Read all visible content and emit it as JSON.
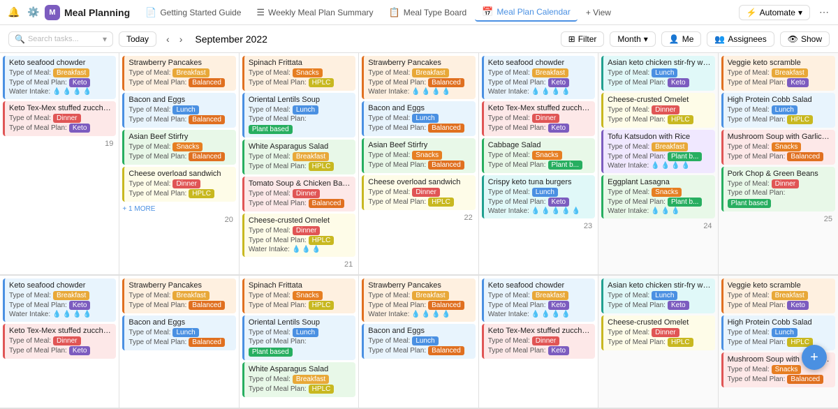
{
  "app": {
    "name": "Meal Planning",
    "icon": "M"
  },
  "tabs": [
    {
      "id": "getting-started",
      "label": "Getting Started Guide",
      "icon": "📄",
      "active": false
    },
    {
      "id": "weekly-summary",
      "label": "Weekly Meal Plan Summary",
      "icon": "☰",
      "active": false
    },
    {
      "id": "meal-type-board",
      "label": "Meal Type Board",
      "icon": "📋",
      "active": false
    },
    {
      "id": "meal-plan-calendar",
      "label": "Meal Plan Calendar",
      "icon": "📅",
      "active": true
    },
    {
      "id": "view",
      "label": "+ View",
      "icon": "",
      "active": false
    }
  ],
  "toolbar": {
    "search_placeholder": "Search tasks...",
    "today_label": "Today",
    "date_range": "September 2022",
    "filter_label": "Filter",
    "month_label": "Month",
    "me_label": "Me",
    "assignees_label": "Assignees",
    "show_label": "Show"
  },
  "automate": {
    "label": "Automate"
  },
  "week1": {
    "days": [
      {
        "num": "19",
        "cards": [
          {
            "title": "Keto seafood chowder",
            "type": "Breakfast",
            "plan": "Keto",
            "water": 4,
            "color": "blue"
          },
          {
            "title": "Keto Tex-Mex stuffed zucchini boat",
            "type": "Dinner",
            "plan": "Keto",
            "color": "pink"
          }
        ]
      },
      {
        "num": "20",
        "cards": [
          {
            "title": "Strawberry Pancakes",
            "type": "Breakfast",
            "plan": "Balanced",
            "water": 0,
            "color": "orange"
          },
          {
            "title": "Bacon and Eggs",
            "type": "Lunch",
            "plan": "Balanced",
            "color": "blue"
          },
          {
            "title": "Asian Beef Stirfry",
            "type": "Snacks",
            "plan": "Balanced",
            "color": "green"
          },
          {
            "title": "Cheese overload sandwich",
            "type": "Dinner",
            "plan": "HPLC",
            "color": "yellow"
          }
        ],
        "more": 1
      },
      {
        "num": "21",
        "cards": [
          {
            "title": "Spinach Frittata",
            "type": "Snacks",
            "plan": "HPLC",
            "color": "orange"
          },
          {
            "title": "Oriental Lentils Soup",
            "type": "Lunch",
            "plan": "Plant based",
            "color": "blue"
          },
          {
            "title": "White Asparagus Salad",
            "type": "Breakfast",
            "plan": "HPLC",
            "color": "green"
          },
          {
            "title": "Tomato Soup & Chicken Barbecue",
            "type": "Dinner",
            "plan": "Balanced",
            "color": "pink"
          },
          {
            "title": "Cheese-crusted Omelet",
            "type": "Dinner",
            "plan": "HPLC",
            "water": 3,
            "color": "yellow"
          }
        ]
      },
      {
        "num": "22",
        "cards": [
          {
            "title": "Strawberry Pancakes",
            "type": "Breakfast",
            "plan": "Balanced",
            "water": 4,
            "color": "orange"
          },
          {
            "title": "Bacon and Eggs",
            "type": "Lunch",
            "plan": "Balanced",
            "color": "blue"
          },
          {
            "title": "Asian Beef Stirfry",
            "type": "Snacks",
            "plan": "Balanced",
            "color": "green"
          },
          {
            "title": "Cheese overload sandwich",
            "type": "Dinner",
            "plan": "HPLC",
            "color": "yellow"
          }
        ]
      },
      {
        "num": "23",
        "cards": [
          {
            "title": "Keto seafood chowder",
            "type": "Breakfast",
            "plan": "Keto",
            "water": 4,
            "color": "blue"
          },
          {
            "title": "Keto Tex-Mex stuffed zucchini b.",
            "type": "Dinner",
            "plan": "Keto",
            "color": "pink"
          },
          {
            "title": "Cabbage Salad",
            "type": "Snacks",
            "plan": "Plant b...",
            "water": 0,
            "color": "green"
          },
          {
            "title": "Crispy keto tuna burgers",
            "type": "Lunch",
            "plan": "Keto",
            "water": 5,
            "color": "teal"
          }
        ]
      },
      {
        "num": "24",
        "cards": [
          {
            "title": "Asian keto chicken stir-fry with bro.",
            "type": "Lunch",
            "plan": "Keto",
            "color": "teal"
          },
          {
            "title": "Cheese-crusted Omelet",
            "type": "Dinner",
            "plan": "HPLC",
            "color": "yellow"
          },
          {
            "title": "Tofu Katsudon with Rice",
            "type": "Breakfast",
            "plan": "Plant b...",
            "water": 4,
            "color": "purple"
          },
          {
            "title": "Eggplant Lasagna",
            "type": "Snacks",
            "plan": "Plant b...",
            "water": 3,
            "color": "green"
          }
        ]
      },
      {
        "num": "25",
        "cards": [
          {
            "title": "Veggie keto scramble",
            "type": "Breakfast",
            "plan": "Keto",
            "color": "orange"
          },
          {
            "title": "High Protein Cobb Salad",
            "type": "Lunch",
            "plan": "HPLC",
            "color": "blue"
          },
          {
            "title": "Mushroom Soup with Garlic Bre.",
            "type": "Snacks",
            "plan": "Balanced",
            "color": "pink"
          },
          {
            "title": "Pork Chop & Green Beans",
            "type": "Dinner",
            "plan": "Plant based",
            "color": "green"
          }
        ]
      }
    ]
  },
  "week2": {
    "days": [
      {
        "num": "",
        "cards": [
          {
            "title": "Keto seafood chowder",
            "type": "Breakfast",
            "plan": "Keto",
            "water": 4,
            "color": "blue"
          },
          {
            "title": "Keto Tex-Mex stuffed zucchini b.",
            "type": "Dinner",
            "plan": "Keto",
            "color": "pink"
          }
        ]
      },
      {
        "num": "",
        "cards": [
          {
            "title": "Strawberry Pancakes",
            "type": "Breakfast",
            "plan": "Balanced",
            "water": 0,
            "color": "orange"
          },
          {
            "title": "Bacon and Eggs",
            "type": "Lunch",
            "plan": "Balanced",
            "color": "blue"
          }
        ]
      },
      {
        "num": "",
        "cards": [
          {
            "title": "Spinach Frittata",
            "type": "Snacks",
            "plan": "HPLC",
            "color": "orange"
          },
          {
            "title": "Oriental Lentils Soup",
            "type": "Lunch",
            "plan": "Plant based",
            "color": "blue"
          },
          {
            "title": "White Asparagus Salad",
            "type": "Breakfast",
            "plan": "HPLC",
            "color": "green"
          }
        ]
      },
      {
        "num": "",
        "cards": [
          {
            "title": "Strawberry Pancakes",
            "type": "Breakfast",
            "plan": "Balanced",
            "water": 4,
            "color": "orange"
          },
          {
            "title": "Bacon and Eggs",
            "type": "Lunch",
            "plan": "Balanced",
            "color": "blue"
          }
        ]
      },
      {
        "num": "",
        "cards": [
          {
            "title": "Keto seafood chowder",
            "type": "Breakfast",
            "plan": "Keto",
            "water": 4,
            "color": "blue"
          },
          {
            "title": "Keto Tex-Mex stuffed zucchini b.",
            "type": "Dinner",
            "plan": "Keto",
            "color": "pink"
          }
        ]
      },
      {
        "num": "",
        "cards": [
          {
            "title": "Asian keto chicken stir-fry with t.",
            "type": "Lunch",
            "plan": "Keto",
            "color": "teal"
          },
          {
            "title": "Cheese-crusted Omelet",
            "type": "Dinner",
            "plan": "HPLC",
            "color": "yellow"
          }
        ]
      },
      {
        "num": "",
        "cards": [
          {
            "title": "Veggie keto scramble",
            "type": "Breakfast",
            "plan": "Keto",
            "color": "orange"
          },
          {
            "title": "High Protein Cobb Salad",
            "type": "Lunch",
            "plan": "HPLC",
            "color": "blue"
          },
          {
            "title": "Mushroom Soup with Garlic B.",
            "type": "Snacks",
            "plan": "Balanced",
            "color": "pink"
          }
        ]
      }
    ]
  },
  "badge_colors": {
    "Breakfast": "breakfast",
    "Lunch": "lunch",
    "Dinner": "dinner",
    "Snacks": "snacks",
    "Keto": "keto",
    "Balanced": "balanced",
    "HPLC": "hplc",
    "Plant based": "plant",
    "Plant b...": "plant"
  }
}
